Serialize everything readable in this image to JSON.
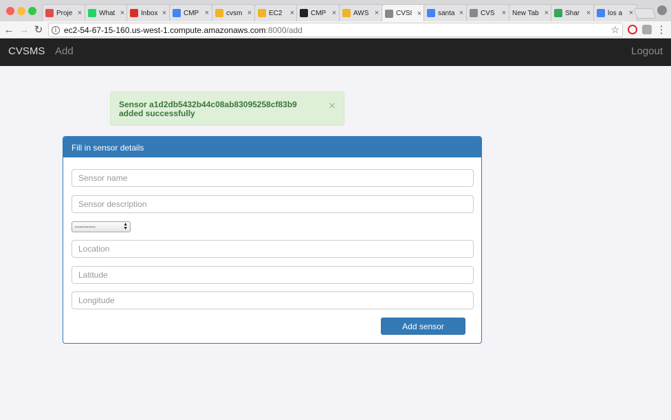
{
  "browser": {
    "tabs": [
      {
        "label": "Proje",
        "icon": "project-icon",
        "color": "#e34c4c"
      },
      {
        "label": "What",
        "icon": "whatsapp-icon",
        "color": "#25d366"
      },
      {
        "label": "Inbox",
        "icon": "gmail-icon",
        "color": "#d93025"
      },
      {
        "label": "CMP",
        "icon": "docs-icon",
        "color": "#4285f4"
      },
      {
        "label": "cvsm",
        "icon": "box-icon",
        "color": "#f0b429"
      },
      {
        "label": "EC2",
        "icon": "box-icon",
        "color": "#f0b429"
      },
      {
        "label": "CMP",
        "icon": "github-icon",
        "color": "#222222"
      },
      {
        "label": "AWS",
        "icon": "box-icon",
        "color": "#f0b429"
      },
      {
        "label": "CVSI",
        "icon": "page-icon",
        "color": "#888888"
      },
      {
        "label": "santa",
        "icon": "google-icon",
        "color": "#4285f4"
      },
      {
        "label": "CVS",
        "icon": "page-icon",
        "color": "#888888"
      },
      {
        "label": "New Tab",
        "icon": "none",
        "color": "#e3e3e6"
      },
      {
        "label": "Shar",
        "icon": "drive-icon",
        "color": "#34a853"
      },
      {
        "label": "los a",
        "icon": "google-icon",
        "color": "#4285f4"
      }
    ],
    "active_tab": 8,
    "tab_close": "×",
    "url_main": "ec2-54-67-15-160.us-west-1.compute.amazonaws.com",
    "url_rest": ":8000/add"
  },
  "navbar": {
    "brand": "CVSMS",
    "add": "Add",
    "logout": "Logout"
  },
  "alert": {
    "text": "Sensor a1d2db5432b44c08ab83095258cf83b9 added successfully",
    "close": "×"
  },
  "form": {
    "heading": "Fill in sensor details",
    "name_placeholder": "Sensor name",
    "description_placeholder": "Sensor description",
    "select_value": "---------",
    "location_placeholder": "Location",
    "latitude_placeholder": "Latitude",
    "longitude_placeholder": "Longitude",
    "submit_label": "Add sensor"
  }
}
